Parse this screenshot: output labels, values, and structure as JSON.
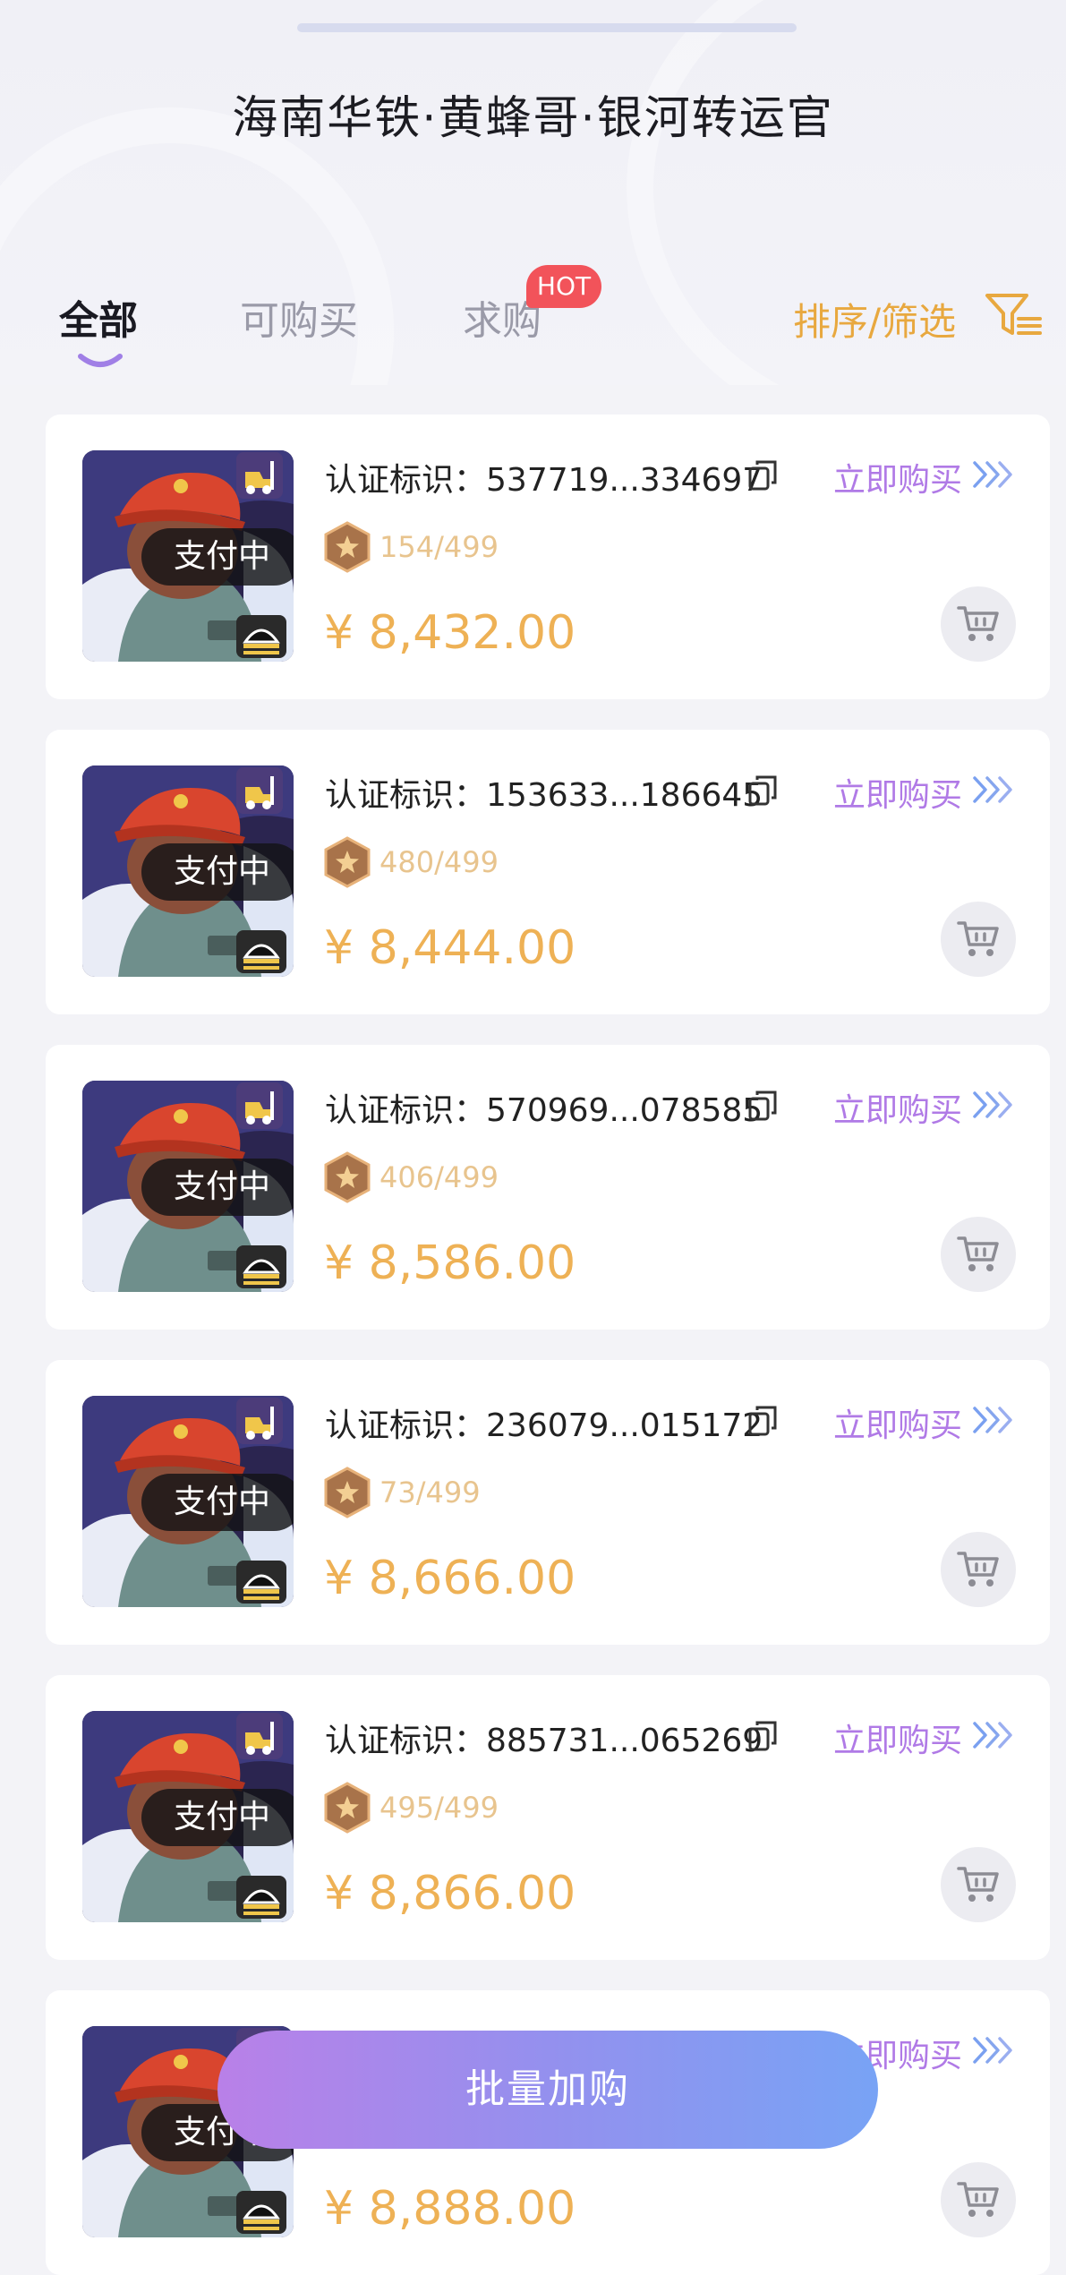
{
  "page": {
    "title": "海南华铁·黄蜂哥·银河转运官"
  },
  "tabs": [
    {
      "label": "全部",
      "active": true
    },
    {
      "label": "可购买",
      "active": false
    },
    {
      "label": "求购",
      "active": false,
      "badge": "HOT"
    }
  ],
  "sort_filter": {
    "label": "排序/筛选",
    "icon": "filter-icon",
    "color": "#e8a83f"
  },
  "listing_defaults": {
    "status_label": "支付中",
    "cert_prefix": "认证标识：",
    "buy_label": "立即购买",
    "currency": "¥",
    "copy_icon": "copy-icon",
    "cart_icon": "cart-icon",
    "edition_icon": "star-hexagon-icon"
  },
  "listings": [
    {
      "cert_id": "537719...334697",
      "edition": "154/499",
      "price": "8,432.00"
    },
    {
      "cert_id": "153633...186645",
      "edition": "480/499",
      "price": "8,444.00"
    },
    {
      "cert_id": "570969...078585",
      "edition": "406/499",
      "price": "8,586.00"
    },
    {
      "cert_id": "236079...015172",
      "edition": "73/499",
      "price": "8,666.00"
    },
    {
      "cert_id": "885731...065269",
      "edition": "495/499",
      "price": "8,866.00"
    },
    {
      "cert_id": "",
      "edition": "",
      "price": "8,888.00"
    }
  ],
  "batch_button": {
    "label": "批量加购"
  },
  "colors": {
    "price": "#eeb155",
    "buy_link": "#b07ae6",
    "hot_badge": "#f2535a",
    "batch_gradient_start": "#b980e8",
    "batch_gradient_end": "#78a3f5"
  }
}
